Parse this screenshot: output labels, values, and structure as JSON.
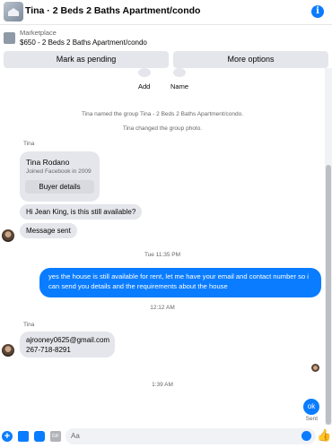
{
  "header": {
    "title": "Tina · 2 Beds 2 Baths Apartment/condo",
    "info_glyph": "i"
  },
  "marketplace": {
    "label": "Marketplace",
    "listing": "$650 - 2 Beds 2 Baths Apartment/condo",
    "mark_pending": "Mark as pending",
    "more_options": "More options"
  },
  "actions": {
    "add": "Add",
    "name": "Name"
  },
  "system": {
    "named_group": "Tina named the group Tina - 2 Beds 2 Baths Apartment/condo.",
    "changed_photo": "Tina changed the group photo."
  },
  "sender_name": "Tina",
  "buyer_card": {
    "name": "Tina Rodano",
    "joined": "Joined Facebook in 2009",
    "button": "Buyer details"
  },
  "messages": {
    "hi": "Hi Jean King, is this still available?",
    "message_sent": "Message sent",
    "outgoing": "yes the house is still available for rent, let me have your email  and contact number so i can send you details and the requirements about the house",
    "email": "ajrooney0625@gmail.com",
    "phone": "267-718-8291",
    "ok": "ok",
    "sent_status": "Sent"
  },
  "timestamps": {
    "t1": "Tue 11:35 PM",
    "t2": "12:12 AM",
    "t3": "1:39 AM"
  },
  "composer": {
    "placeholder": "Aa",
    "gif_label": "GIF",
    "like_glyph": "👍"
  },
  "colors": {
    "accent": "#0a7cff",
    "bubble_gray": "#e4e6eb"
  }
}
